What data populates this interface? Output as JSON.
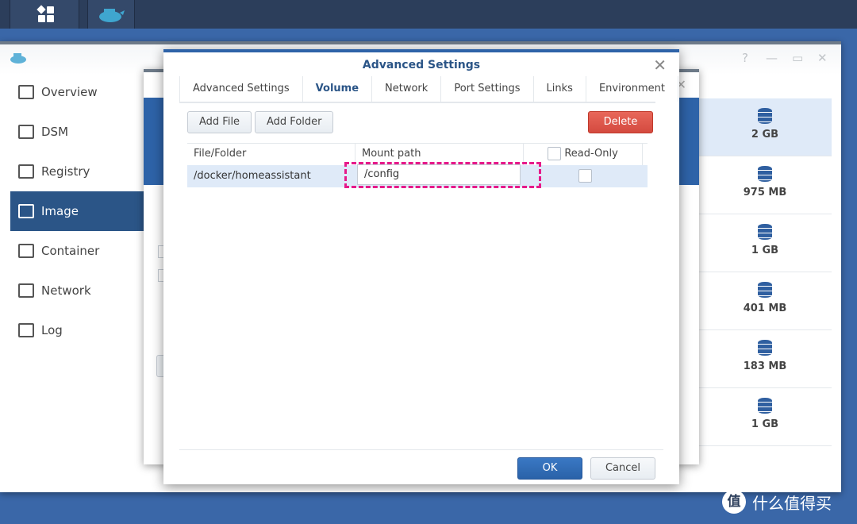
{
  "taskbar": {
    "icons": [
      "app-grid-icon",
      "docker-icon"
    ]
  },
  "sidebar": {
    "items": [
      {
        "label": "Overview",
        "icon": "overview-icon"
      },
      {
        "label": "DSM",
        "icon": "dsm-icon"
      },
      {
        "label": "Registry",
        "icon": "registry-icon"
      },
      {
        "label": "Image",
        "icon": "image-icon",
        "active": true
      },
      {
        "label": "Container",
        "icon": "container-icon"
      },
      {
        "label": "Network",
        "icon": "network-icon"
      },
      {
        "label": "Log",
        "icon": "log-icon"
      }
    ]
  },
  "image_sizes": [
    "2 GB",
    "975 MB",
    "1 GB",
    "401 MB",
    "183 MB",
    "1 GB"
  ],
  "dialog": {
    "title": "Advanced Settings",
    "tabs": [
      "Advanced Settings",
      "Volume",
      "Network",
      "Port Settings",
      "Links",
      "Environment"
    ],
    "active_tab": "Volume",
    "buttons": {
      "add_file": "Add File",
      "add_folder": "Add Folder",
      "delete": "Delete",
      "ok": "OK",
      "cancel": "Cancel"
    },
    "columns": {
      "file_folder": "File/Folder",
      "mount_path": "Mount path",
      "read_only": "Read-Only"
    },
    "rows": [
      {
        "file_folder": "/docker/homeassistant",
        "mount_path": "/config",
        "read_only": false
      }
    ]
  },
  "colors": {
    "accent": "#2b5587",
    "delete": "#d9534f",
    "highlight": "#e6198a"
  },
  "watermark": {
    "logo": "值",
    "text": "什么值得买"
  }
}
